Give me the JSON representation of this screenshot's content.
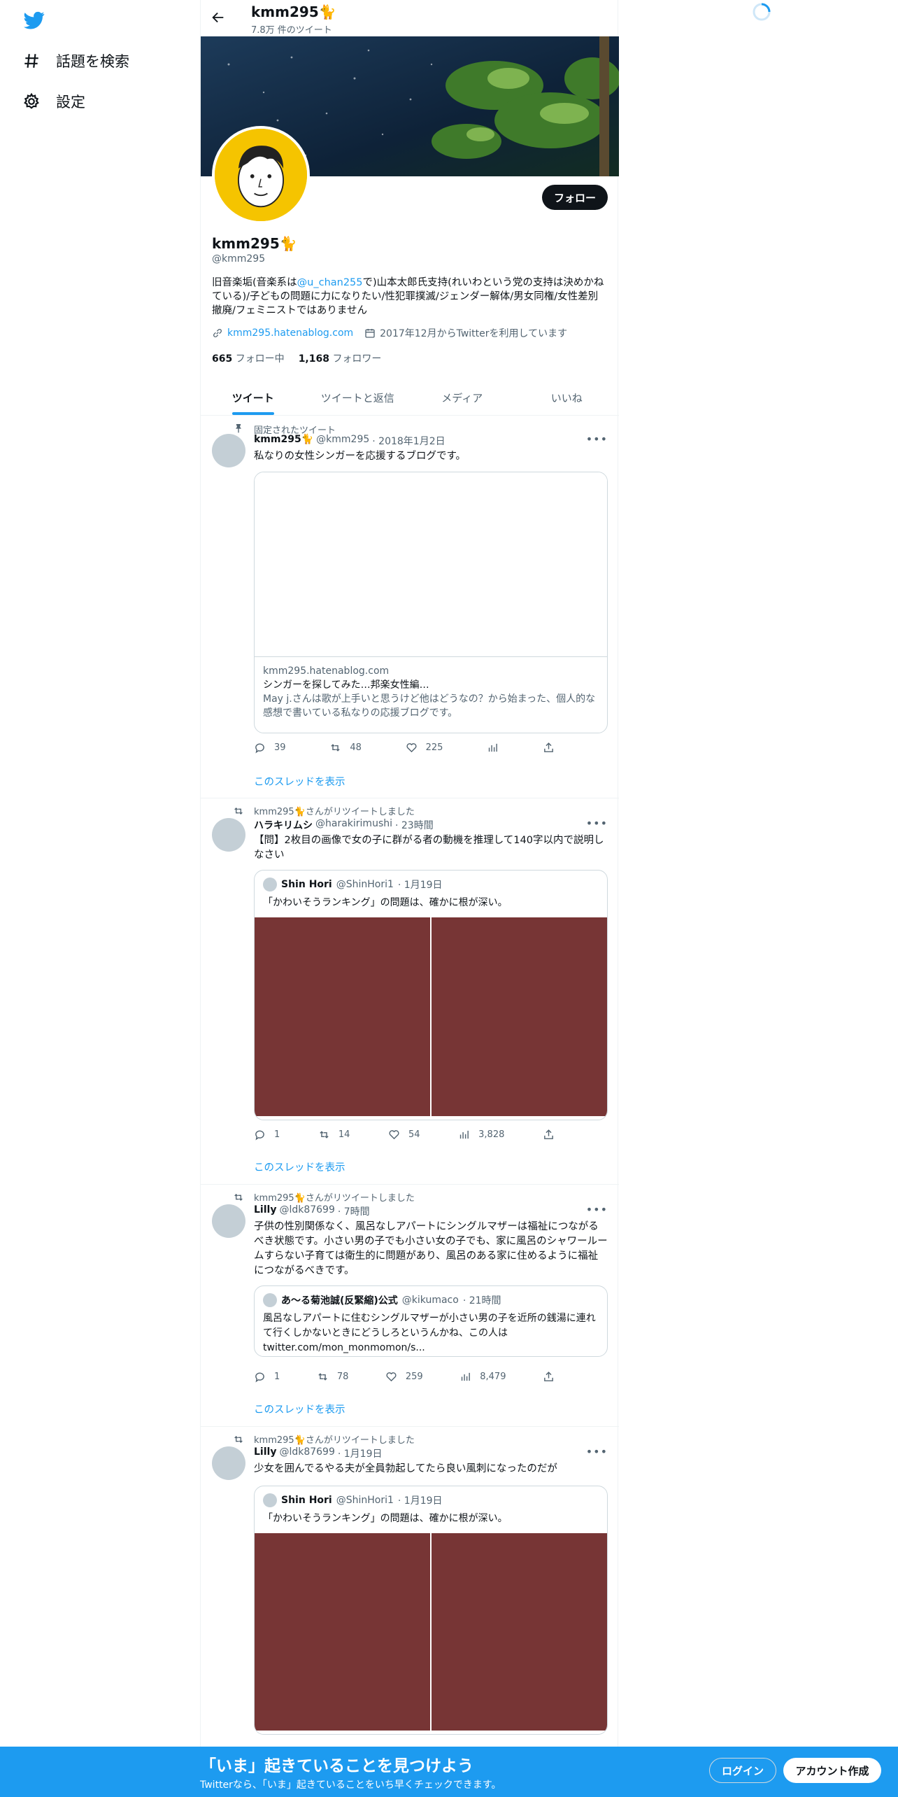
{
  "nav": {
    "explore_label": "話題を検索",
    "settings_label": "設定"
  },
  "header": {
    "name": "kmm295🐈",
    "tweet_count": "7.8万 件のツイート"
  },
  "profile": {
    "name": "kmm295🐈",
    "handle": "@kmm295",
    "follow_label": "フォロー",
    "bio_before": "旧音楽垢(音楽系は",
    "bio_mention": "@u_chan255",
    "bio_after": "で)山本太郎氏支持(れいわという党の支持は決めかねている)/子どもの問題に力になりたい/性犯罪撲滅/ジェンダー解体/男女同権/女性差別撤廃/フェミニストではありません",
    "website": "kmm295.hatenablog.com",
    "joined": "2017年12月からTwitterを利用しています",
    "following_count": "665",
    "following_label": "フォロー中",
    "followers_count": "1,168",
    "followers_label": "フォロワー"
  },
  "tabs": [
    "ツイート",
    "ツイートと返信",
    "メディア",
    "いいね"
  ],
  "tweets": [
    {
      "social": "固定されたツイート",
      "name": "kmm295🐈",
      "handle": "@kmm295",
      "time": "· 2018年1月2日",
      "text": "私なりの女性シンガーを応援するブログです。",
      "card_domain": "kmm295.hatenablog.com",
      "card_title": "シンガーを探してみた…邦楽女性編…",
      "card_desc": "May j.さんは歌が上手いと思うけど他はどうなの？から始まった、個人的な感想で書いている私なりの応援ブログです。",
      "replies": "39",
      "retweets": "48",
      "likes": "225",
      "thread": "このスレッドを表示"
    },
    {
      "social": "kmm295🐈さんがリツイートしました",
      "name": "ハラキリムシ",
      "handle": "@harakirimushi",
      "time": "· 23時間",
      "text": "【問】2枚目の画像で女の子に群がる者の動機を推理して140字以内で説明しなさい",
      "quote_name": "Shin Hori",
      "quote_handle": "@ShinHori1",
      "quote_time": "· 1月19日",
      "quote_text": "「かわいそうランキング」の問題は、確かに根が深い。",
      "replies": "1",
      "retweets": "14",
      "likes": "54",
      "views": "3,828",
      "thread": "このスレッドを表示"
    },
    {
      "social": "kmm295🐈さんがリツイートしました",
      "name": "Lilly",
      "handle": "@ldk87699",
      "time": "· 7時間",
      "text": "子供の性別関係なく、風呂なしアパートにシングルマザーは福祉につながるべき状態です。小さい男の子でも小さい女の子でも、家に風呂のシャワールームすらない子育ては衛生的に問題があり、風呂のある家に住めるように福祉につながるべきです。",
      "quote_name": "あ〜る菊池誠(反緊縮)公式",
      "quote_handle": "@kikumaco",
      "quote_time": "· 21時間",
      "quote_text": "風呂なしアパートに住むシングルマザーが小さい男の子を近所の銭湯に連れて行くしかないときにどうしろというんかね、この人は twitter.com/mon_monmomon/s...",
      "replies": "1",
      "retweets": "78",
      "likes": "259",
      "views": "8,479",
      "thread": "このスレッドを表示"
    },
    {
      "social": "kmm295🐈さんがリツイートしました",
      "name": "Lilly",
      "handle": "@ldk87699",
      "time": "· 1月19日",
      "text": "少女を囲んでるやる夫が全員勃起してたら良い風刺になったのだが",
      "quote_name": "Shin Hori",
      "quote_handle": "@ShinHori1",
      "quote_time": "· 1月19日",
      "quote_text": "「かわいそうランキング」の問題は、確かに根が深い。"
    }
  ],
  "bottom_bar": {
    "title": "「いま」起きていることを見つけよう",
    "subtitle": "Twitterなら、「いま」起きていることをいち早くチェックできます。",
    "login": "ログイン",
    "signup": "アカウント作成"
  },
  "colors": {
    "accent": "#1d9bf0",
    "media_placeholder": "#773535"
  }
}
